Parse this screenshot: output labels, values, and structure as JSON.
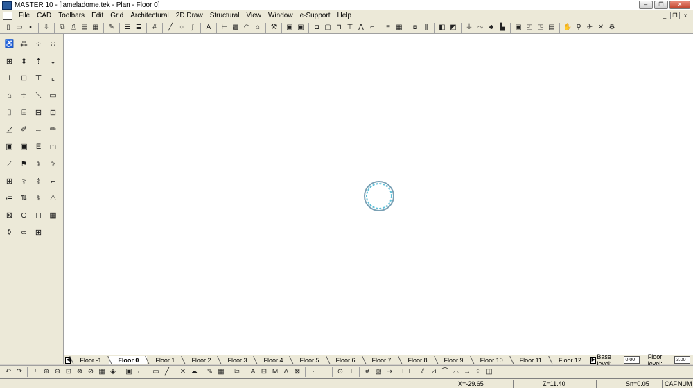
{
  "window": {
    "title": "MASTER 10 - [lameladome.tek - Plan - Floor 0]"
  },
  "window_buttons": {
    "minimize": "–",
    "maximize": "❐",
    "close": "✕"
  },
  "menu": {
    "items": [
      "File",
      "CAD",
      "Toolbars",
      "Edit",
      "Grid",
      "Architectural",
      "2D Draw",
      "Structural",
      "View",
      "Window",
      "e-Support",
      "Help"
    ]
  },
  "mdi_buttons": {
    "minimize": "_",
    "restore": "❐",
    "close": "x"
  },
  "floors": {
    "prev_label": "◀",
    "next_label": "▶",
    "tabs": [
      "Floor -1",
      "Floor 0",
      "Floor 1",
      "Floor 2",
      "Floor 3",
      "Floor 4",
      "Floor 5",
      "Floor 6",
      "Floor 7",
      "Floor 8",
      "Floor 9",
      "Floor 10",
      "Floor 11",
      "Floor 12"
    ],
    "active": "Floor 0"
  },
  "levels": {
    "base_label": "Base level:",
    "base_value": "0.00",
    "floor_label": "Floor level:",
    "floor_value": "3.00"
  },
  "status": {
    "x": "X=-29.65",
    "z": "Z=11.40",
    "sn": "Sn=0.05",
    "caf": "CAF",
    "num": "NUM"
  },
  "colors": {
    "canvas": "#ffffff",
    "chrome": "#ece9d8",
    "dome_outline": "#7aa0b4",
    "dome_fill": "#5fc0d8"
  }
}
